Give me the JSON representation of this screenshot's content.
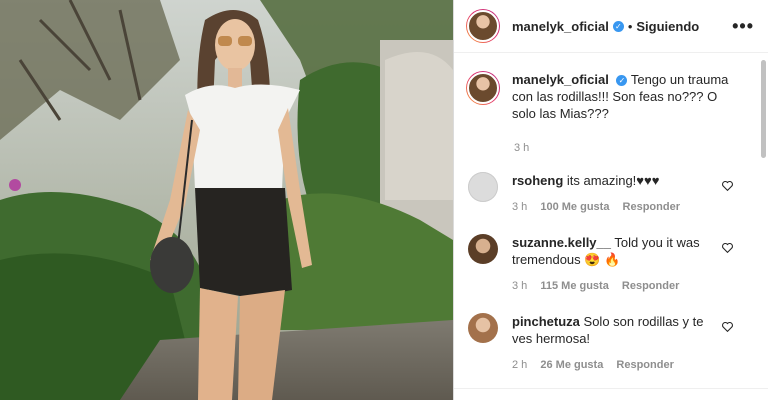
{
  "post": {
    "username": "manelyk_oficial",
    "separator": "•",
    "follow_status": "Siguiendo",
    "more": "•••"
  },
  "caption": {
    "username": "manelyk_oficial",
    "text": "Tengo un trauma con las rodillas!!! Son feas no??? O solo las Mias???",
    "time": "3 h"
  },
  "comments": [
    {
      "username": "rsoheng",
      "text": "its amazing!♥♥♥",
      "time": "3 h",
      "likes": "100 Me gusta",
      "reply": "Responder"
    },
    {
      "username": "suzanne.kelly__",
      "text": "Told you it was tremendous 😍 🔥",
      "time": "3 h",
      "likes": "115 Me gusta",
      "reply": "Responder"
    },
    {
      "username": "pinchetuza",
      "text": "Solo son rodillas y te ves hermosa!",
      "time": "2 h",
      "likes": "26 Me gusta",
      "reply": "Responder"
    }
  ],
  "colors": {
    "verified": "#3897f0",
    "muted": "#8e8e8e",
    "text": "#262626"
  },
  "icons": [
    "verified-badge-icon",
    "more-options-icon",
    "heart-icon"
  ]
}
